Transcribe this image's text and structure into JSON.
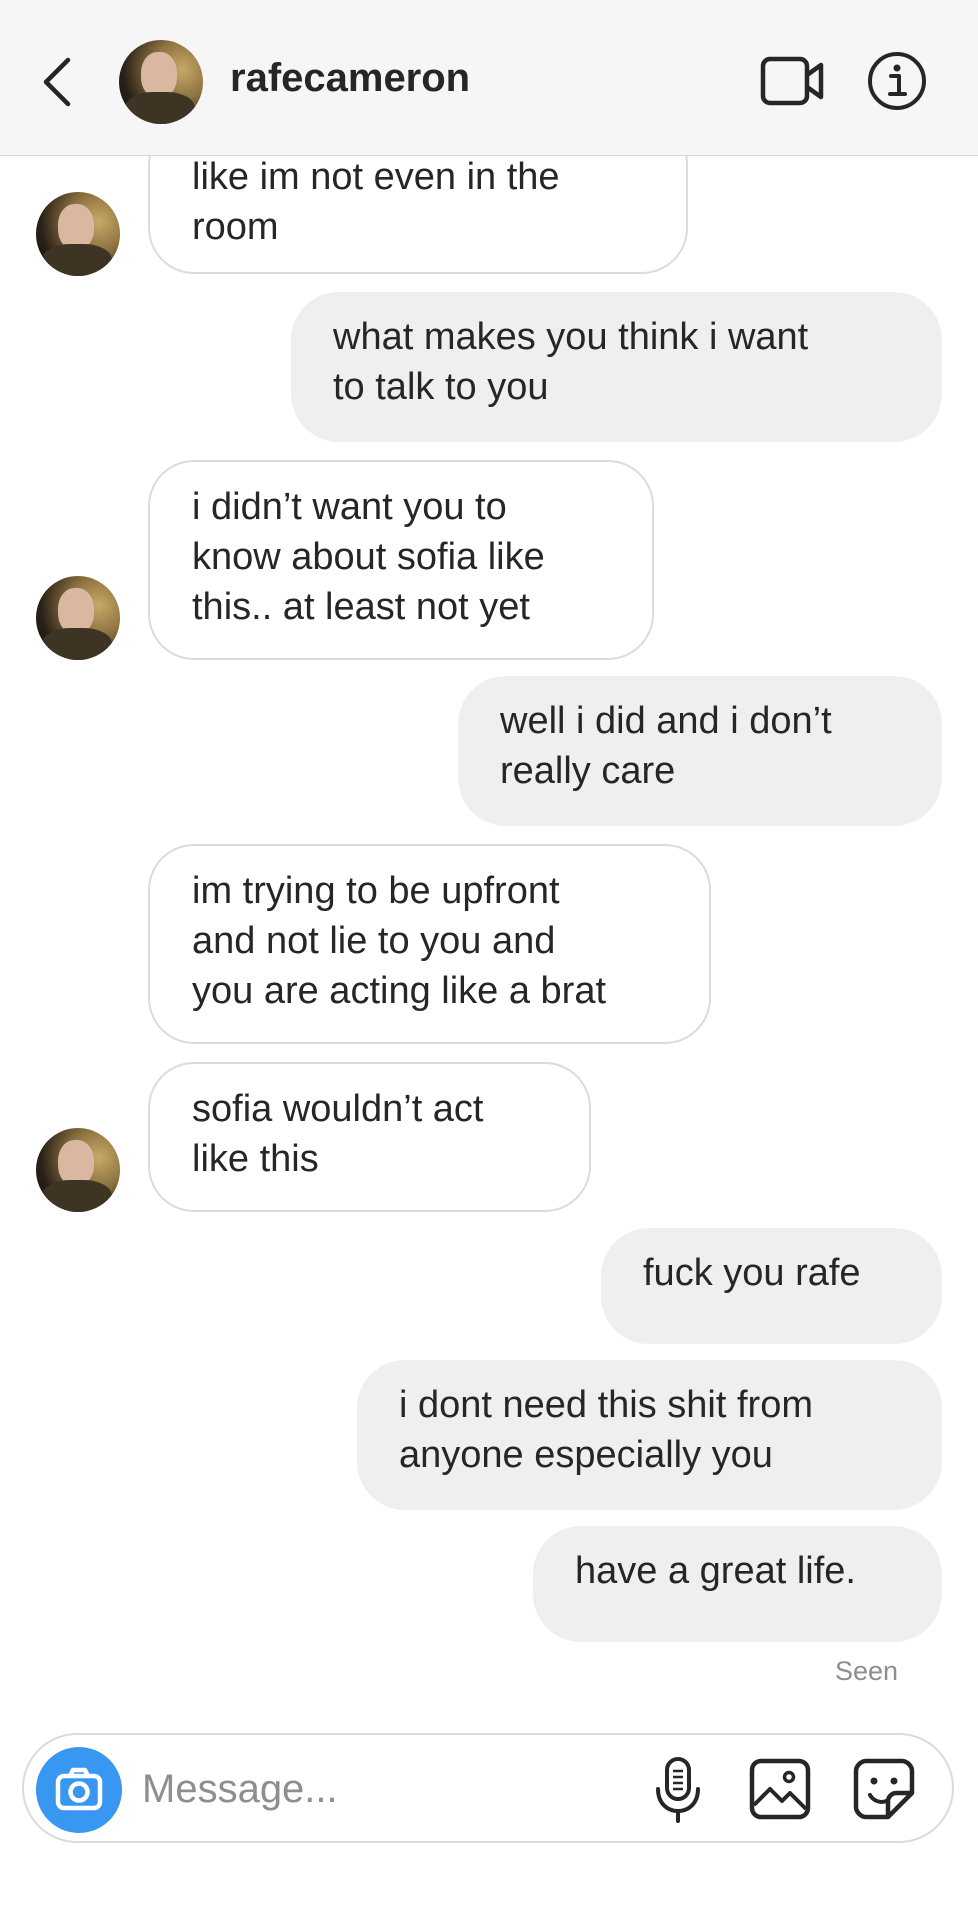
{
  "header": {
    "username": "rafecameron",
    "icons": {
      "back": "chevron-left-icon",
      "video": "video-camera-icon",
      "info": "info-icon"
    }
  },
  "messages": [
    {
      "from": "them",
      "text": "like im not even in the\nroom"
    },
    {
      "from": "me",
      "text": "what makes you think i want\nto talk to you"
    },
    {
      "from": "them",
      "text": "i didn’t want you to\nknow about sofia like\nthis.. at least not yet"
    },
    {
      "from": "me",
      "text": "well i did and i don’t\nreally care"
    },
    {
      "from": "them",
      "text": "im trying to be upfront\nand not lie to you and\nyou are acting like a brat"
    },
    {
      "from": "them",
      "text": "sofia wouldn’t act\nlike this"
    },
    {
      "from": "me",
      "text": "fuck you rafe"
    },
    {
      "from": "me",
      "text": "i dont need this shit from\nanyone especially you"
    },
    {
      "from": "me",
      "text": "have a great life."
    }
  ],
  "status": {
    "seen": "Seen"
  },
  "composer": {
    "placeholder": "Message...",
    "icons": {
      "camera": "camera-icon",
      "mic": "microphone-icon",
      "gallery": "gallery-icon",
      "sticker": "sticker-icon"
    },
    "accent_color": "#3897f0"
  }
}
